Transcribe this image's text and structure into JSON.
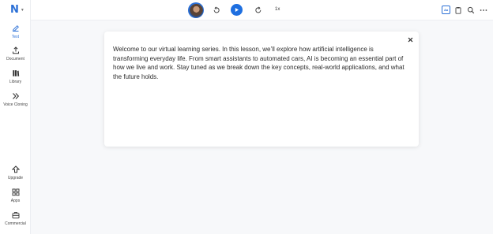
{
  "app": {
    "logo_letter": "N"
  },
  "sidebar": {
    "items": [
      {
        "label": "Text",
        "icon": "edit-icon",
        "active": true
      },
      {
        "label": "Document",
        "icon": "upload-icon"
      },
      {
        "label": "Library",
        "icon": "library-icon"
      },
      {
        "label": "Voice Cloning",
        "icon": "chevrons-right-icon"
      },
      {
        "label": "Upgrade",
        "icon": "upgrade-icon"
      },
      {
        "label": "Apps",
        "icon": "apps-grid-icon"
      },
      {
        "label": "Commercial",
        "icon": "briefcase-icon"
      }
    ]
  },
  "toolbar": {
    "speed": "1x",
    "ab_label": "Aa"
  },
  "editor": {
    "text": "Welcome to our virtual learning series. In this lesson, we’ll explore how artificial intelligence is transforming everyday life. From smart assistants to automated cars, AI is becoming an essential part of how we live and work. Stay tuned as we break down the key concepts, real-world applications, and what the future holds."
  },
  "colors": {
    "accent": "#2a6fd6",
    "play": "#1e6fe0"
  }
}
